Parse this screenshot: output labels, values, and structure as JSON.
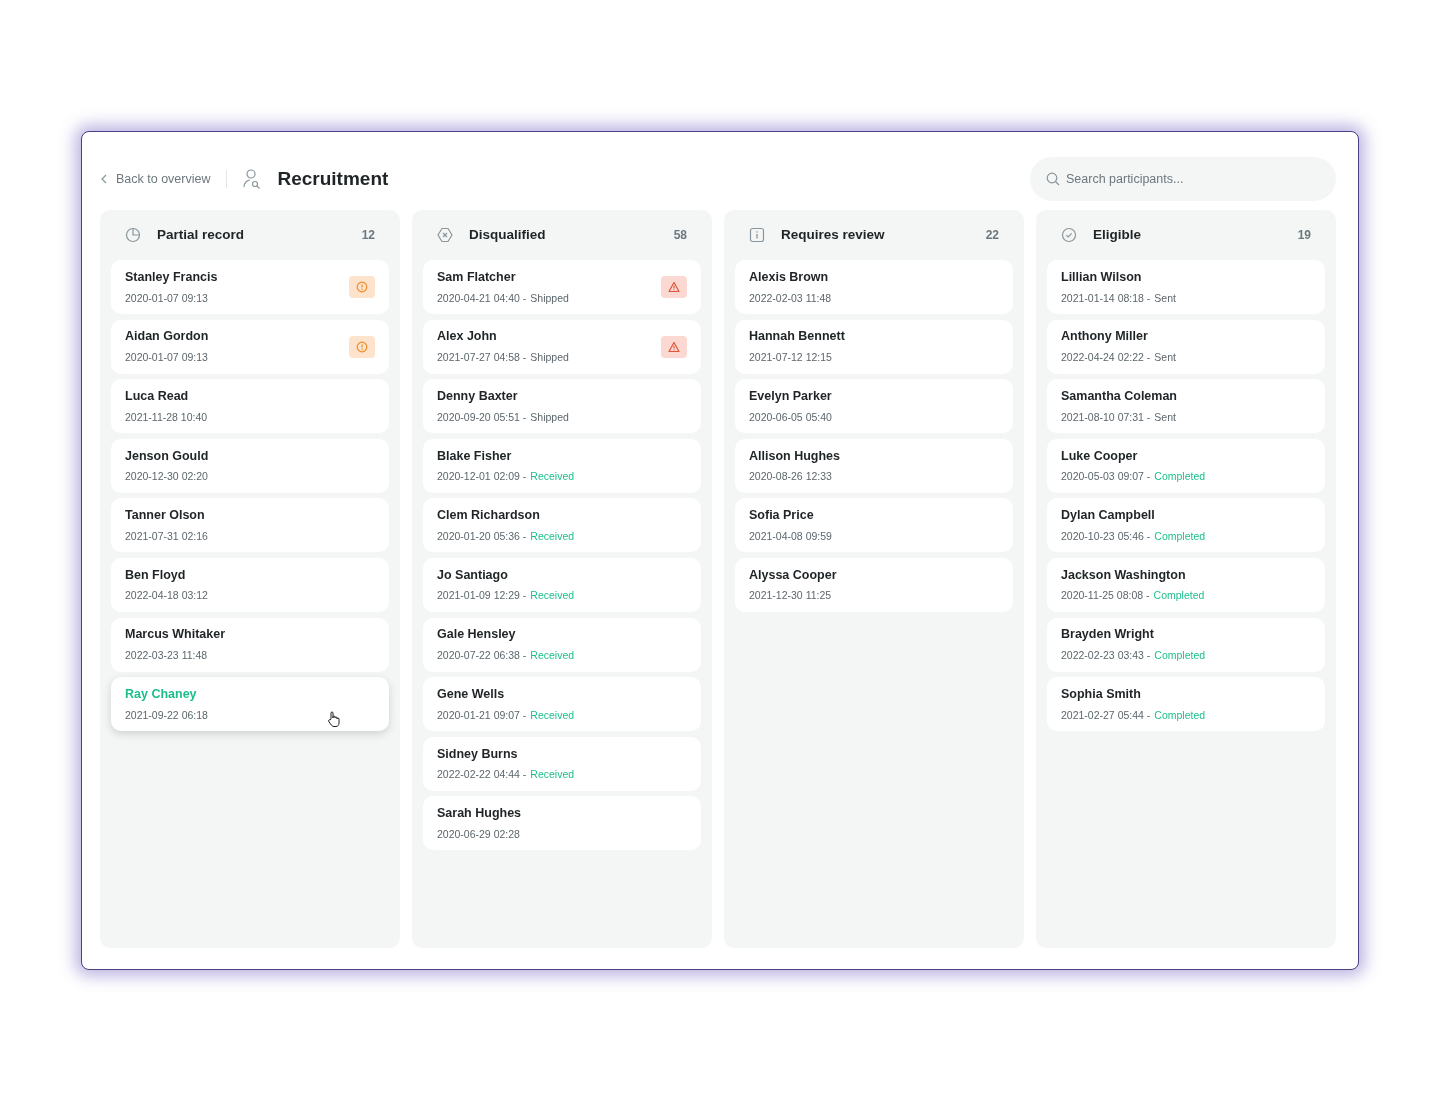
{
  "header": {
    "back_link": "Back to overview",
    "title": "Recruitment",
    "search": {
      "placeholder": "Search participants..."
    }
  },
  "columns": [
    {
      "title": "Partial record",
      "kind": "clock",
      "count": "12",
      "cards": [
        {
          "name": "Stanley Francis",
          "date": "2020-01-07 09:13",
          "kind": "warning",
          "hovered": false
        },
        {
          "name": "Aidan Gordon",
          "date": "2020-01-07 09:13",
          "kind": "warning",
          "hovered": false
        },
        {
          "name": "Luca Read",
          "date": "2021-11-28 10:40",
          "kind": "plain",
          "hovered": false
        },
        {
          "name": "Jenson Gould",
          "date": "2020-12-30 02:20",
          "kind": "plain",
          "hovered": false
        },
        {
          "name": "Tanner Olson",
          "date": "2021-07-31 02:16",
          "kind": "plain",
          "hovered": false
        },
        {
          "name": "Ben Floyd",
          "date": "2022-04-18 03:12",
          "kind": "plain",
          "hovered": false
        },
        {
          "name": "Marcus Whitaker",
          "date": "2022-03-23 11:48",
          "kind": "plain",
          "hovered": false
        },
        {
          "name": "Ray Chaney",
          "date": "2021-09-22 06:18",
          "kind": "plain",
          "hovered": true
        }
      ]
    },
    {
      "title": "Disqualified",
      "kind": "cross",
      "count": "58",
      "cards": [
        {
          "name": "Sam Flatcher",
          "date": "2020-04-21 04:40 -",
          "status": {
            "text": "Shipped",
            "color": "#5b666b"
          },
          "kind": "alert",
          "hovered": false
        },
        {
          "name": "Alex John",
          "date": "2021-07-27 04:58 -",
          "status": {
            "text": "Shipped",
            "color": "#5b666b"
          },
          "kind": "alert",
          "hovered": false
        },
        {
          "name": "Denny Baxter",
          "date": "2020-09-20 05:51 -",
          "status": {
            "text": "Shipped",
            "color": "#5b666b"
          },
          "kind": "plain",
          "hovered": false
        },
        {
          "name": "Blake Fisher",
          "date": "2020-12-01 02:09 -",
          "status": {
            "text": "Received",
            "color": "#1cbf8c"
          },
          "kind": "plain",
          "hovered": false
        },
        {
          "name": "Clem Richardson",
          "date": "2020-01-20 05:36 -",
          "status": {
            "text": "Received",
            "color": "#1cbf8c"
          },
          "kind": "plain",
          "hovered": false
        },
        {
          "name": "Jo Santiago",
          "date": "2021-01-09 12:29 -",
          "status": {
            "text": "Received",
            "color": "#1cbf8c"
          },
          "kind": "plain",
          "hovered": false
        },
        {
          "name": "Gale Hensley",
          "date": "2020-07-22 06:38 -",
          "status": {
            "text": "Received",
            "color": "#1cbf8c"
          },
          "kind": "plain",
          "hovered": false
        },
        {
          "name": "Gene Wells",
          "date": "2020-01-21 09:07 -",
          "status": {
            "text": "Received",
            "color": "#1cbf8c"
          },
          "kind": "plain",
          "hovered": false
        },
        {
          "name": "Sidney Burns",
          "date": "2022-02-22 04:44 -",
          "status": {
            "text": "Received",
            "color": "#1cbf8c"
          },
          "kind": "plain",
          "hovered": false
        },
        {
          "name": "Sarah Hughes",
          "date": "2020-06-29 02:28",
          "kind": "plain",
          "hovered": false
        }
      ]
    },
    {
      "title": "Requires review",
      "kind": "info",
      "count": "22",
      "cards": [
        {
          "name": "Alexis Brown",
          "date": "2022-02-03 11:48",
          "kind": "plain",
          "hovered": false
        },
        {
          "name": "Hannah Bennett",
          "date": "2021-07-12 12:15",
          "kind": "plain",
          "hovered": false
        },
        {
          "name": "Evelyn Parker",
          "date": "2020-06-05 05:40",
          "kind": "plain",
          "hovered": false
        },
        {
          "name": "Allison Hughes",
          "date": "2020-08-26 12:33",
          "kind": "plain",
          "hovered": false
        },
        {
          "name": "Sofia Price",
          "date": "2021-04-08 09:59",
          "kind": "plain",
          "hovered": false
        },
        {
          "name": "Alyssa Cooper",
          "date": "2021-12-30 11:25",
          "kind": "plain",
          "hovered": false
        }
      ]
    },
    {
      "title": "Eligible",
      "kind": "check",
      "count": "19",
      "cards": [
        {
          "name": "Lillian Wilson",
          "date": "2021-01-14 08:18 -",
          "status": {
            "text": "Sent",
            "color": "#5b666b"
          },
          "kind": "plain",
          "hovered": false
        },
        {
          "name": "Anthony Miller",
          "date": "2022-04-24 02:22 -",
          "status": {
            "text": "Sent",
            "color": "#5b666b"
          },
          "kind": "plain",
          "hovered": false
        },
        {
          "name": "Samantha Coleman",
          "date": "2021-08-10 07:31 -",
          "status": {
            "text": "Sent",
            "color": "#5b666b"
          },
          "kind": "plain",
          "hovered": false
        },
        {
          "name": "Luke Cooper",
          "date": "2020-05-03 09:07 -",
          "status": {
            "text": "Completed",
            "color": "#1cbf8c"
          },
          "kind": "plain",
          "hovered": false
        },
        {
          "name": "Dylan Campbell",
          "date": "2020-10-23 05:46 -",
          "status": {
            "text": "Completed",
            "color": "#1cbf8c"
          },
          "kind": "plain",
          "hovered": false
        },
        {
          "name": "Jackson Washington",
          "date": "2020-11-25 08:08 -",
          "status": {
            "text": "Completed",
            "color": "#1cbf8c"
          },
          "kind": "plain",
          "hovered": false
        },
        {
          "name": "Brayden Wright",
          "date": "2022-02-23 03:43 -",
          "status": {
            "text": "Completed",
            "color": "#1cbf8c"
          },
          "kind": "plain",
          "hovered": false
        },
        {
          "name": "Sophia Smith",
          "date": "2021-02-27 05:44 -",
          "status": {
            "text": "Completed",
            "color": "#1cbf8c"
          },
          "kind": "plain",
          "hovered": false
        }
      ]
    }
  ]
}
